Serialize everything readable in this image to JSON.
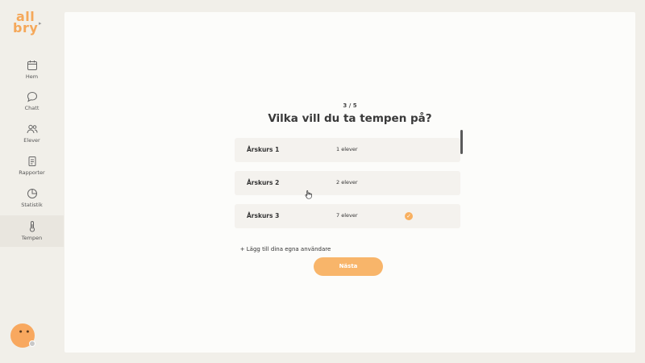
{
  "brand": {
    "logo_line1": "all",
    "logo_line2": "bry",
    "color": "#f5a85a"
  },
  "sidebar": {
    "items": [
      {
        "label": "Hem",
        "icon": "calendar-icon"
      },
      {
        "label": "Chatt",
        "icon": "chat-icon"
      },
      {
        "label": "Elever",
        "icon": "users-icon"
      },
      {
        "label": "Rapporter",
        "icon": "report-icon"
      },
      {
        "label": "Statistik",
        "icon": "pie-chart-icon"
      },
      {
        "label": "Tempen",
        "icon": "thermometer-icon",
        "active": true
      }
    ]
  },
  "wizard": {
    "step": "3 / 5",
    "question": "Vilka vill du ta tempen på?",
    "rows": [
      {
        "name": "Årskurs 1",
        "count": "1 elever",
        "selected": false
      },
      {
        "name": "Årskurs 2",
        "count": "2 elever",
        "selected": false
      },
      {
        "name": "Årskurs 3",
        "count": "7 elever",
        "selected": true
      }
    ],
    "add_link": "+ Lägg till dina egna användare",
    "next_label": "Nästa"
  },
  "colors": {
    "accent": "#f8b56a",
    "background": "#f1efe9",
    "panel": "#fcfcfa"
  }
}
